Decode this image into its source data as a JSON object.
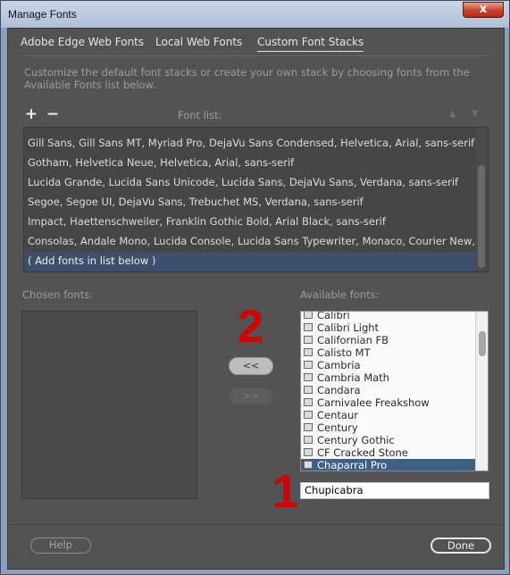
{
  "window": {
    "title": "Manage Fonts",
    "close_label": "x"
  },
  "tabs": [
    {
      "label": "Adobe Edge Web Fonts",
      "active": false
    },
    {
      "label": "Local Web Fonts",
      "active": false
    },
    {
      "label": "Custom Font Stacks",
      "active": true
    }
  ],
  "description": "Customize the default font stacks or create your own stack by choosing fonts from the Available Fonts list below.",
  "font_list": {
    "add_label": "+",
    "remove_label": "−",
    "label": "Font list:",
    "up_label": "▲",
    "down_label": "▼",
    "items": [
      "Gill Sans, Gill Sans MT, Myriad Pro, DejaVu Sans Condensed, Helvetica, Arial, sans-serif",
      "Gotham, Helvetica Neue, Helvetica, Arial, sans-serif",
      "Lucida Grande, Lucida Sans Unicode, Lucida Sans, DejaVu Sans, Verdana, sans-serif",
      "Segoe, Segoe UI, DejaVu Sans, Trebuchet MS, Verdana, sans-serif",
      "Impact, Haettenschweiler, Franklin Gothic Bold, Arial Black, sans-serif",
      "Consolas, Andale Mono, Lucida Console, Lucida Sans Typewriter, Monaco, Courier New, monos...",
      "( Add fonts in list below )"
    ],
    "selected_index": 6
  },
  "chosen_fonts": {
    "label": "Chosen fonts:",
    "items": []
  },
  "move_buttons": {
    "add_label": "<<",
    "remove_label": ">>"
  },
  "available_fonts": {
    "label": "Available fonts:",
    "items": [
      "Calibri",
      "Calibri Light",
      "Californian FB",
      "Calisto MT",
      "Cambria",
      "Cambria Math",
      "Candara",
      "Carnivalee Freakshow",
      "Centaur",
      "Century",
      "Century Gothic",
      "CF Cracked Stone",
      "Chaparral Pro"
    ],
    "selected_index": 12,
    "input_value": "Chupicabra"
  },
  "annotations": {
    "step_1": "1",
    "step_2": "2",
    "color": "#d40000"
  },
  "footer": {
    "help_label": "Help",
    "done_label": "Done"
  }
}
